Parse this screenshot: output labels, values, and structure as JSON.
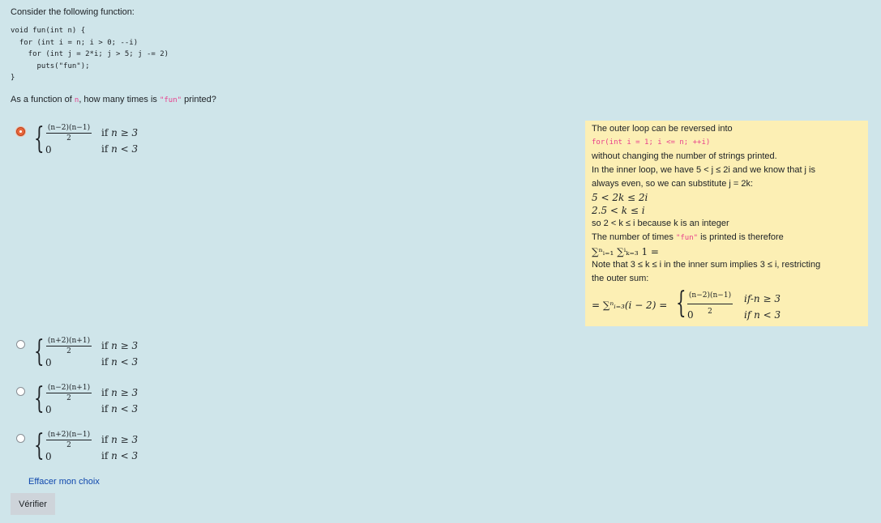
{
  "intro": "Consider the following function:",
  "code_lines": [
    "void fun(int n) {",
    "  for (int i = n; i > 0; --i)",
    "    for (int j = 2*i; j > 5; j -= 2)",
    "      puts(\"fun\");",
    "}"
  ],
  "question": {
    "prefix": "As a function of ",
    "var": "n",
    "middle": ", how many times is ",
    "string": "\"fun\"",
    "suffix": " printed?"
  },
  "options": [
    {
      "numerator": "(n−2)(n−1)",
      "denominator": "2",
      "zero": "0",
      "cond1": "n ≥ 3",
      "cond2": "n < 3",
      "selected": true
    },
    {
      "numerator": "(n+2)(n+1)",
      "denominator": "2",
      "zero": "0",
      "cond1": "n ≥ 3",
      "cond2": "n < 3",
      "selected": false
    },
    {
      "numerator": "(n−2)(n+1)",
      "denominator": "2",
      "zero": "0",
      "cond1": "n ≥ 3",
      "cond2": "n < 3",
      "selected": false
    },
    {
      "numerator": "(n+2)(n−1)",
      "denominator": "2",
      "zero": "0",
      "cond1": "n ≥ 3",
      "cond2": "n < 3",
      "selected": false
    }
  ],
  "if_word": "if ",
  "feedback": {
    "line1": "The outer loop can be reversed into",
    "code": "for(int i = 1; i <= n; ++i)",
    "line2": "without changing the number of strings printed.",
    "line3": "In the inner loop, we have 5 < j ≤ 2i and we know that j is",
    "line4": "always even, so we can substitute j = 2k:",
    "math1": "5 < 2k ≤ 2i",
    "math2": "2.5 < k ≤ i",
    "line5": "so 2 < k ≤ i because k is an integer",
    "line6_prefix": "The number of times ",
    "line6_string": "\"fun\"",
    "line6_suffix": " is printed is therefore",
    "math3": "∑ⁿᵢ₌₁ ∑ⁱₖ₌₃ 1 =",
    "line7": "Note that 3 ≤ k ≤ i in the inner sum implies 3 ≤ i, restricting",
    "line8": "the outer sum:",
    "final_lead": "= ∑ⁿᵢ₌₃(i − 2) =",
    "final_numerator": "(n−2)(n−1)",
    "final_denominator": "2",
    "final_zero": "0",
    "final_cond1": "if-n ≥ 3",
    "final_cond2": "if n < 3"
  },
  "clear_label": "Effacer mon choix",
  "verify_label": "Vérifier"
}
